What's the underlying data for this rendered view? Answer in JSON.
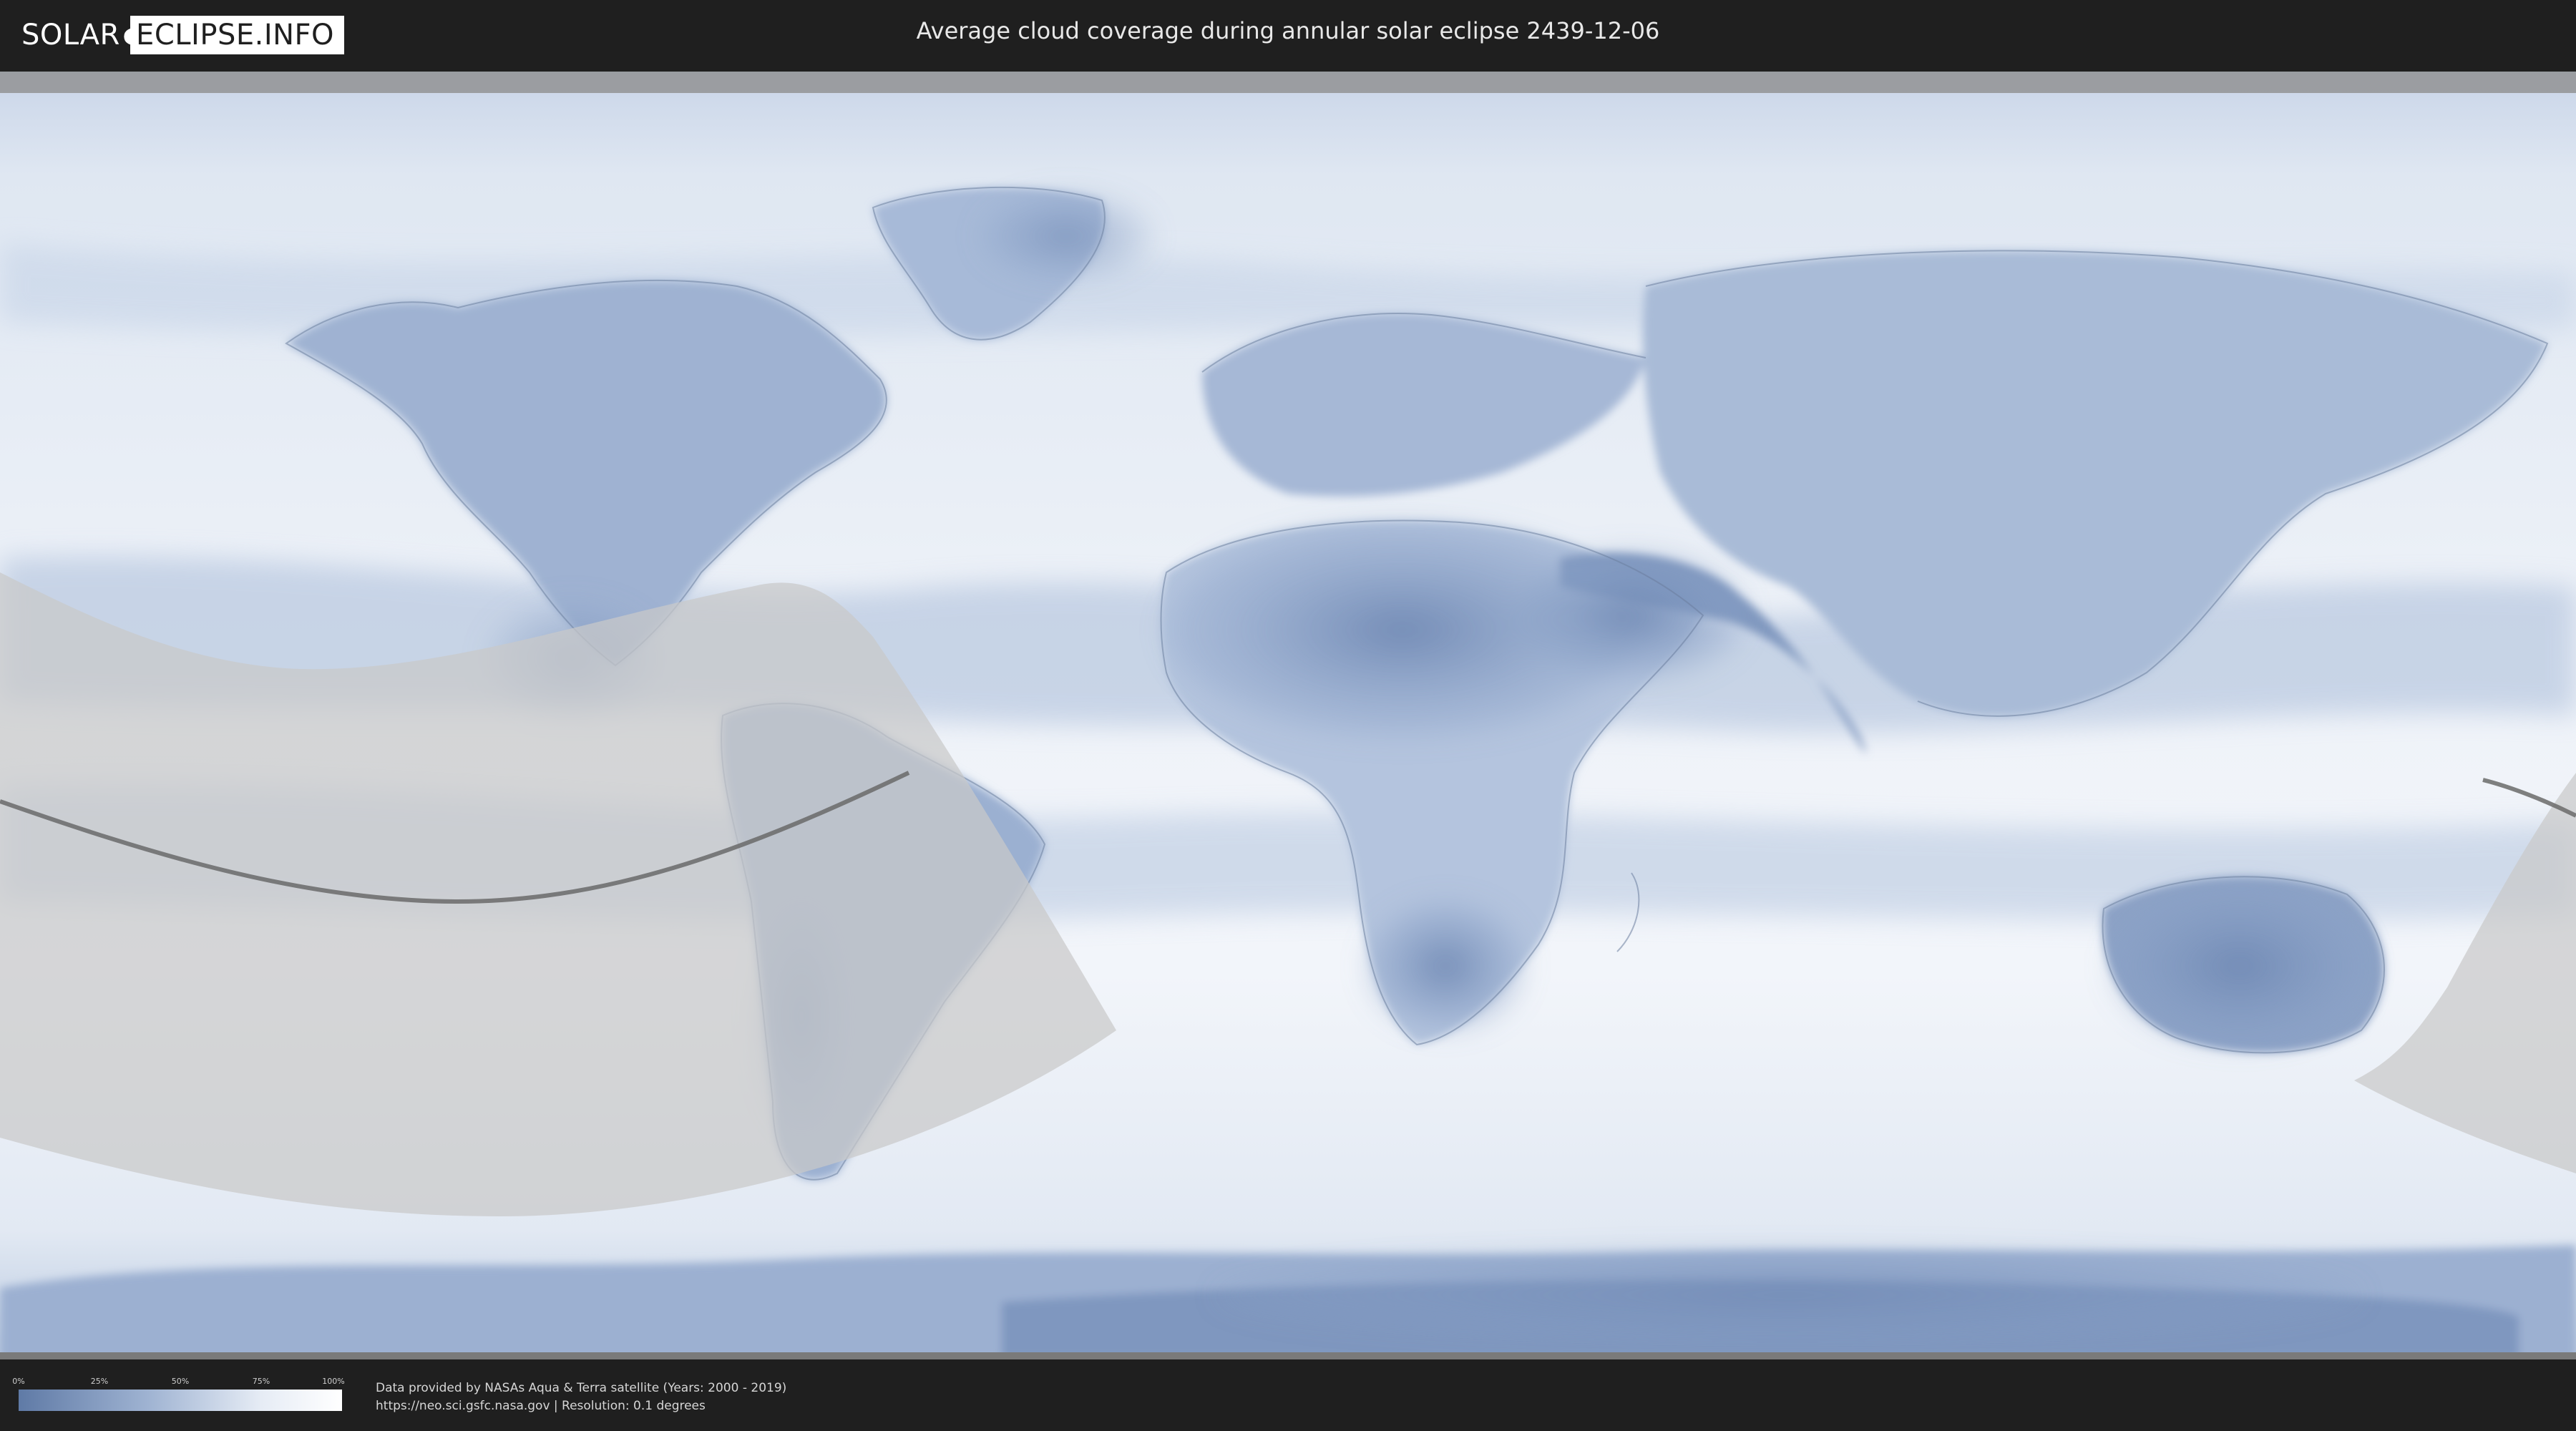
{
  "header": {
    "logo_left": "SOLAR",
    "logo_right": "ECLIPSE.INFO",
    "title": "Average cloud coverage during annular solar eclipse 2439-12-06"
  },
  "legend": {
    "ticks": [
      "0%",
      "25%",
      "50%",
      "75%",
      "100%"
    ],
    "colors": {
      "low": "#5f7aa6",
      "mid": "#9fb3d2",
      "high": "#ffffff"
    }
  },
  "footer": {
    "line1": "Data provided by NASAs Aqua & Terra satellite (Years: 2000 - 2019)",
    "line2": "https://neo.sci.gsfc.nasa.gov | Resolution: 0.1 degrees"
  },
  "colors": {
    "background": "#1f1f1f",
    "ocean_cloud": "#e9eef6",
    "clear_sky": "#7f98c0",
    "eclipse_zone": "#c8c8c8",
    "central_line": "#6a6a6a"
  }
}
